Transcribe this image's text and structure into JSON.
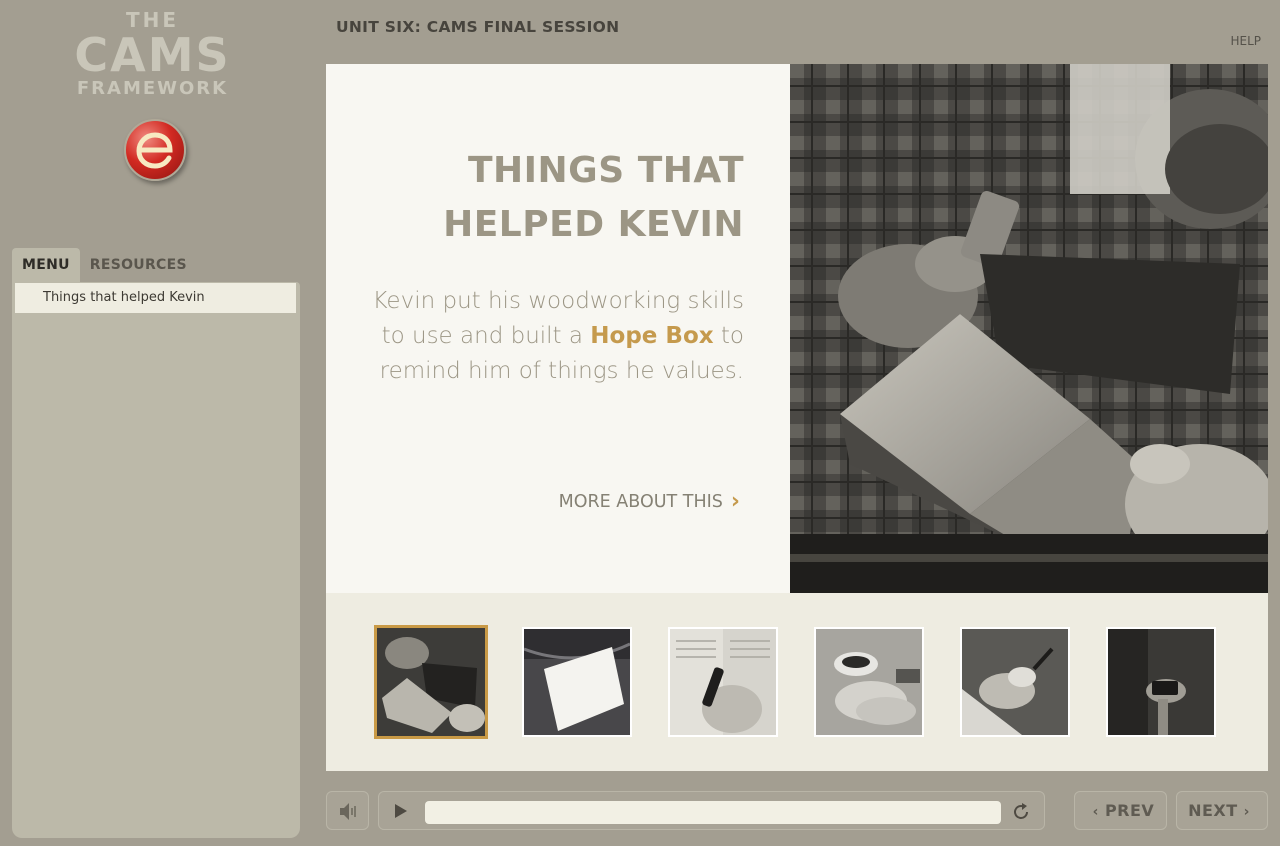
{
  "logo": {
    "line1": "THE",
    "line2": "CAMS",
    "line3": "FRAMEWORK"
  },
  "header": {
    "unit_title": "UNIT SIX: CAMS FINAL SESSION",
    "help": "HELP"
  },
  "sidebar": {
    "tabs": [
      {
        "label": "MENU",
        "active": true
      },
      {
        "label": "RESOURCES",
        "active": false
      }
    ],
    "items": [
      {
        "label": "Things that helped Kevin",
        "selected": true
      }
    ]
  },
  "content": {
    "heading_line1": "THINGS THAT",
    "heading_line2": "HELPED KEVIN",
    "body_pre": "Kevin put his woodworking skills to use and built a",
    "body_highlight": "Hope Box",
    "body_post": "to remind him of things he values.",
    "more_link": "MORE ABOUT THIS",
    "more_icon": "chevron-right-icon"
  },
  "thumbnails": [
    {
      "name": "woodworking",
      "selected": true
    },
    {
      "name": "card-in-pocket",
      "selected": false
    },
    {
      "name": "writing-in-book",
      "selected": false
    },
    {
      "name": "holding-hands-coffee",
      "selected": false
    },
    {
      "name": "hands-crafting",
      "selected": false
    },
    {
      "name": "holding-phone",
      "selected": false
    }
  ],
  "controls": {
    "mute_icon": "speaker-icon",
    "play_icon": "play-icon",
    "replay_icon": "replay-icon",
    "prev_label": "PREV",
    "next_label": "NEXT"
  },
  "colors": {
    "accent": "#c59a4d",
    "background": "#a39e91",
    "panel": "#bcb9a9",
    "heading": "#9c9685"
  }
}
